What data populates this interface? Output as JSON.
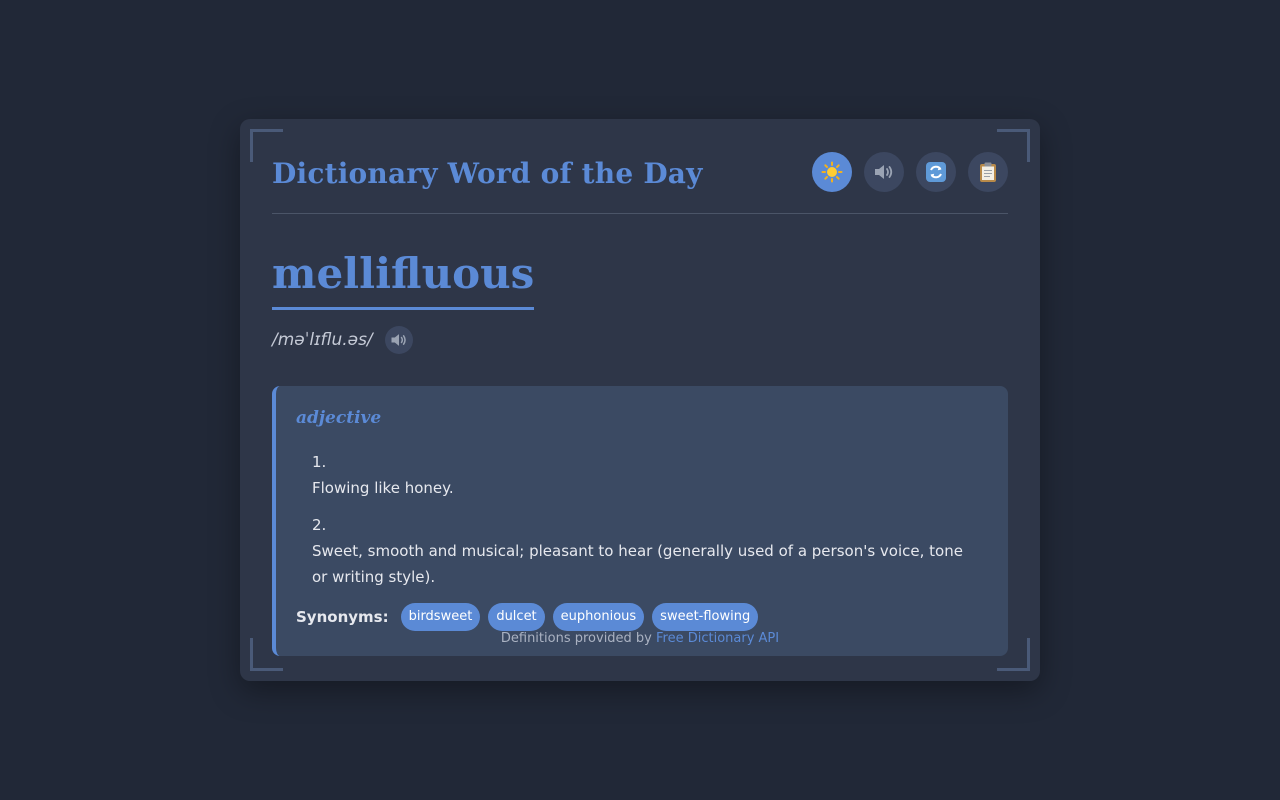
{
  "app": {
    "title": "Dictionary Word of the Day"
  },
  "toolbar": {
    "buttons": [
      {
        "name": "theme-toggle-button",
        "icon": "sun-icon",
        "active": true
      },
      {
        "name": "speak-button",
        "icon": "speaker-icon",
        "active": false
      },
      {
        "name": "refresh-button",
        "icon": "refresh-icon",
        "active": false
      },
      {
        "name": "copy-button",
        "icon": "clipboard-icon",
        "active": false
      }
    ]
  },
  "word": {
    "text": "mellifluous",
    "phonetic": "/məˈlɪflu.əs/",
    "phonetic_speaker_icon": "speaker-icon"
  },
  "meaning": {
    "part_of_speech": "adjective",
    "definitions": [
      {
        "number": "1.",
        "text": "Flowing like honey."
      },
      {
        "number": "2.",
        "text": "Sweet, smooth and musical; pleasant to hear (generally used of a person's voice, tone or writing style)."
      }
    ],
    "synonyms_label": "Synonyms:",
    "synonyms": [
      "birdsweet",
      "dulcet",
      "euphonious",
      "sweet-flowing"
    ]
  },
  "footer": {
    "prefix": "Definitions provided by ",
    "link_text": "Free Dictionary API"
  },
  "colors": {
    "background": "#212837",
    "card": "#2e3648",
    "accent": "#5b8ad6",
    "panel": "#3b4a63"
  }
}
